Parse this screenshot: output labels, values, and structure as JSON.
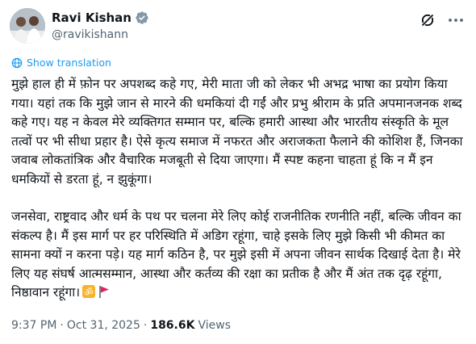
{
  "author": {
    "name": "Ravi Kishan",
    "handle": "@ravikishann",
    "verified_color": "#829aab"
  },
  "translate": {
    "label": "Show translation",
    "color": "#1d9bf0"
  },
  "tweet": {
    "paragraph_1": "मुझे हाल ही में फ़ोन पर अपशब्द कहे गए, मेरी माता जी को लेकर भी अभद्र भाषा का प्रयोग किया गया। यहां तक कि मुझे जान से मारने की धमकियां दी गईं और प्रभु श्रीराम के प्रति अपमानजनक शब्द कहे गए। यह न केवल मेरे व्यक्तिगत सम्मान पर, बल्कि हमारी आस्था और भारतीय संस्कृति के मूल तत्वों पर भी सीधा प्रहार है। ऐसे कृत्य समाज में नफरत और अराजकता फैलाने की कोशिश हैं, जिनका जवाब लोकतांत्रिक और वैचारिक मजबूती से दिया जाएगा। मैं स्पष्ट कहना चाहता हूं कि न मैं इन धमकियों से डरता हूं, न झुकूंगा।",
    "paragraph_2": "जनसेवा, राष्ट्रवाद और धर्म के पथ पर चलना मेरे लिए कोई राजनीतिक रणनीति नहीं, बल्कि जीवन का संकल्प है। मैं इस मार्ग पर हर परिस्थिति में अडिग रहूंगा, चाहे इसके लिए मुझे किसी भी कीमत का सामना क्यों न करना पड़े। यह मार्ग कठिन है, पर मुझे इसी में अपना जीवन सार्थक दिखाई देता है। मेरे लिए यह संघर्ष आत्मसम्मान, आस्था और कर्तव्य की रक्षा का प्रतीक है और मैं अंत तक दृढ़ रहूंगा, निष्ठावान रहूंगा।",
    "emojis": [
      "om-emoji",
      "red-flag-emoji"
    ]
  },
  "meta": {
    "time": "9:37 PM",
    "separator": "·",
    "date": "Oct 31, 2025",
    "views_count": "186.6K",
    "views_label": "Views"
  },
  "icons": {
    "grok": "grok-icon",
    "more": "more-icon",
    "translate": "globe-icon"
  }
}
